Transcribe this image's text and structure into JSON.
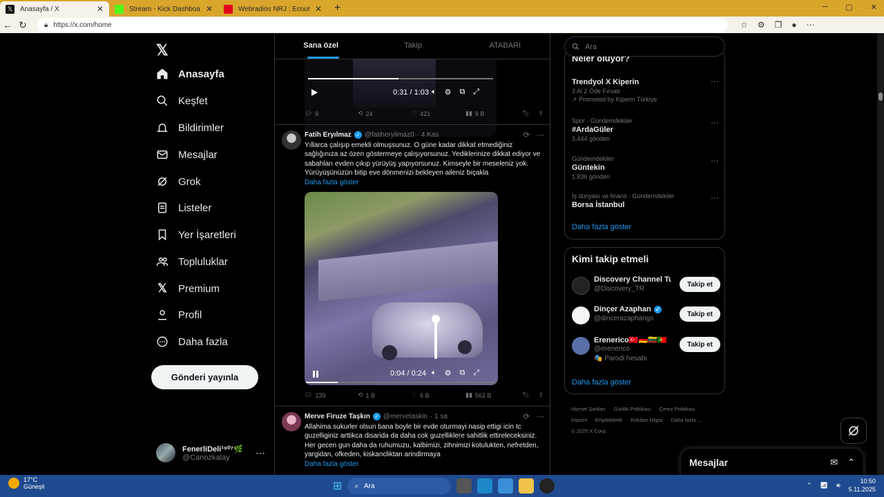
{
  "browser": {
    "tabs": [
      {
        "title": "Anasayfa / X",
        "active": true,
        "color": "#111111"
      },
      {
        "title": "Stream - Kick Dashboard",
        "active": false,
        "color": "#53fc18"
      },
      {
        "title": "Webradios NRJ : Ecoute en direct",
        "active": false,
        "color": "#e2001a"
      }
    ],
    "url": "https://x.com/home"
  },
  "nav": {
    "items": [
      {
        "label": "Anasayfa",
        "icon": "home-icon"
      },
      {
        "label": "Keşfet",
        "icon": "search-icon"
      },
      {
        "label": "Bildirimler",
        "icon": "bell-icon"
      },
      {
        "label": "Mesajlar",
        "icon": "mail-icon"
      },
      {
        "label": "Grok",
        "icon": "grok-icon"
      },
      {
        "label": "Listeler",
        "icon": "list-icon"
      },
      {
        "label": "Yer İşaretleri",
        "icon": "bookmark-icon"
      },
      {
        "label": "Topluluklar",
        "icon": "people-icon"
      },
      {
        "label": "Premium",
        "icon": "x-logo-icon"
      },
      {
        "label": "Profil",
        "icon": "person-icon"
      },
      {
        "label": "Daha fazla",
        "icon": "more-circle-icon"
      }
    ],
    "post_button": "Gönderi yayınla",
    "user": {
      "name": "FenerliDeli¹⁹⁰⁷🌿",
      "handle": "@Canozkalay"
    }
  },
  "feed": {
    "tabs": [
      "Sana özel",
      "Takip",
      "ATABARI"
    ],
    "video1": {
      "time": "0:31 / 1:03",
      "progress": 0.49
    },
    "post1_stats": {
      "replies": "6",
      "reposts": "24",
      "likes": "421",
      "views": "9 B"
    },
    "post2": {
      "name": "Fatih Eryılmaz",
      "handle": "@fatiheryilmaz0",
      "date": "· 4 Kas",
      "text": "Yıllarca çalışıp emekli olmuşsunuz. O güne kadar dikkat etmediğiniz sağlığınıza az özen göstermeye çalışıyorsunuz. Yediklerinize dikkat ediyor ve sabahları evden çıkıp yürüyüş yapıyorsunuz. Kimseyle bir meseleniz yok. Yürüyüşünüzün bitip eve dönmenizi bekleyen aileniz bıçakla",
      "more": "Daha fazla göster",
      "video_time": "0:04 / 0:24",
      "video_progress": 0.17,
      "stats": {
        "replies": "139",
        "reposts": "1 B",
        "likes": "6 B",
        "views": "562 B"
      }
    },
    "post3": {
      "name": "Merve Firuze Taşkın",
      "handle": "@mervetaskin",
      "date": "· 1 sa",
      "text": "Allahima sukurler olsun bana boyle bir evde oturmayi nasip ettigi icin Ic guzelliginiz arttikca disarida da daha cok guzelliklere sahitlik ettireleceksiniz. Her gecen gun daha da ruhumuzu, kalbimizi, zihnimizi kotulukten, nefretden, yargidan, ofkeden, kiskancliktan arindirmaya",
      "more": "Daha fazla göster"
    }
  },
  "right": {
    "search_placeholder": "Ara",
    "trends_title": "Neler oluyor?",
    "trends": [
      {
        "context": "",
        "title": "Trendyol X Kiperin",
        "sub": "3 Al 2 Öde Fırsatı",
        "count": "Promoted by Kiperin Türkiye"
      },
      {
        "context": "Spor · Gündemdekiler",
        "title": "#ArdaGüler",
        "sub": "",
        "count": "3.444 gönderi"
      },
      {
        "context": "Gündemdekiler",
        "title": "Güntekin",
        "sub": "",
        "count": "1.836 gönderi"
      },
      {
        "context": "İş dünyası ve finans · Gündemdekiler",
        "title": "Borsa İstanbul",
        "sub": "",
        "count": ""
      }
    ],
    "trends_more": "Daha fazla göster",
    "who_title": "Kimi takip etmeli",
    "suggestions": [
      {
        "name": "Discovery Channel Tu...",
        "handle": "@Discovery_TR",
        "extra": "",
        "verified": false,
        "color": "#222222"
      },
      {
        "name": "Dinçer Azaphan",
        "handle": "@dincerazaphangs",
        "extra": "",
        "verified": true,
        "color": "#f5f5f5"
      },
      {
        "name": "Erenerico🇹🇷🇩🇪🇱🇹🇵🇹",
        "handle": "@erenerico",
        "extra": "🎭 Parodi hesabı",
        "verified": false,
        "color": "#5a6fa8"
      }
    ],
    "follow_label": "Takip et",
    "who_more": "Daha fazla göster",
    "footer": [
      "Hizmet Şartları",
      "Gizlilik Politikası",
      "Çerez Politikası",
      "İmprint",
      "Erişilebilirlik",
      "Reklam bilgisi",
      "Daha fazla ...",
      "© 2025 X Corp."
    ],
    "messages_label": "Mesajlar"
  },
  "taskbar": {
    "temp": "17°C",
    "weather": "Güneşli",
    "search": "Ara",
    "time": "10:50",
    "date": "5.11.2025"
  }
}
